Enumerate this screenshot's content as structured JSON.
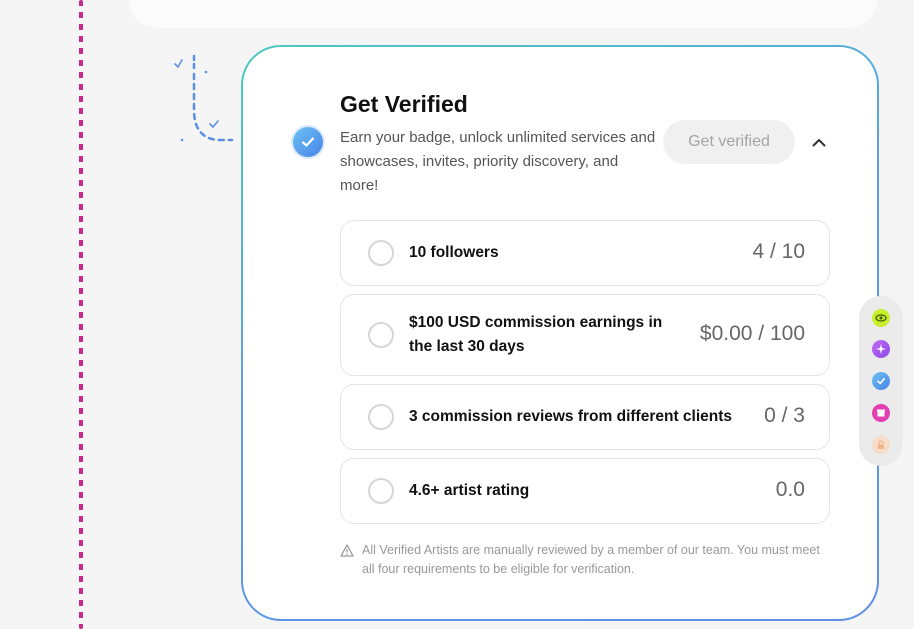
{
  "card": {
    "title": "Get Verified",
    "description": "Earn your badge, unlock unlimited services and showcases, invites, priority discovery, and more!",
    "button_label": "Get verified"
  },
  "requirements": [
    {
      "label": "10 followers",
      "value": "4 / 10"
    },
    {
      "label": "$100 USD commission earnings in the last 30 days",
      "value": "$0.00 / 100"
    },
    {
      "label": "3 commission reviews from different clients",
      "value": "0 / 3"
    },
    {
      "label": "4.6+ artist rating",
      "value": "0.0"
    }
  ],
  "footnote": "All Verified Artists are manually reviewed by a member of our team. You must meet all four requirements to be eligible for verification.",
  "side_rail": {
    "icons": [
      "eye-icon",
      "sparkle-icon",
      "verified-icon",
      "shop-icon",
      "lock-icon"
    ]
  },
  "colors": {
    "accent_gradient_start": "#4bc9c0",
    "accent_gradient_end": "#5f8fe6",
    "dashed_line": "#c82a8a",
    "button_bg": "#f0f0f0",
    "button_text": "#a5a5a5"
  }
}
